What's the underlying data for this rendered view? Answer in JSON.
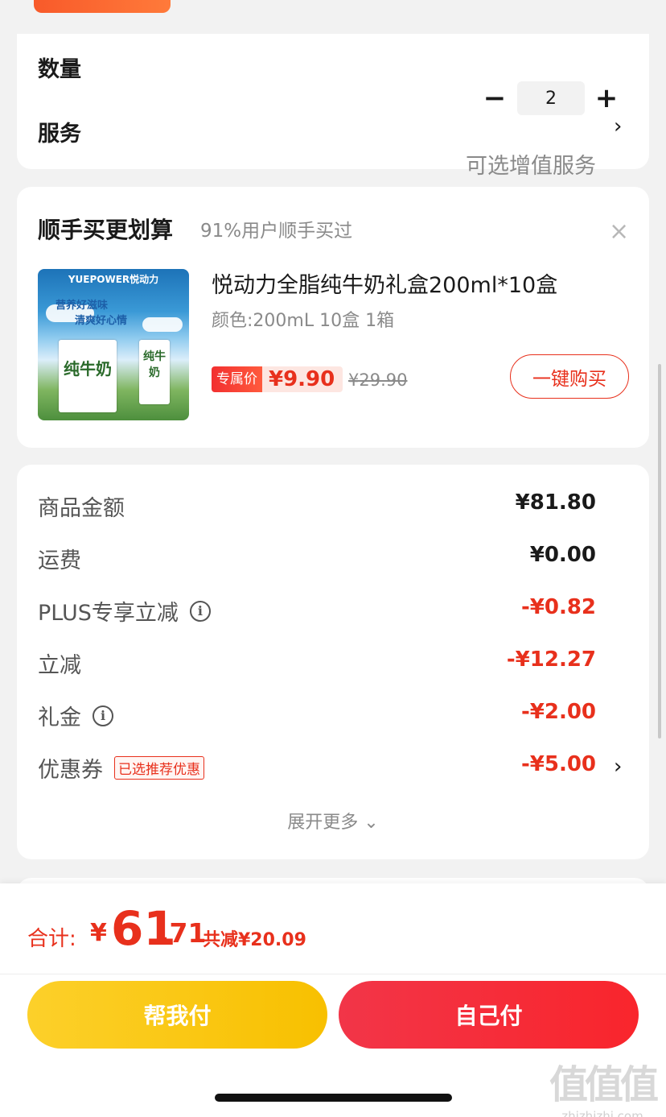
{
  "quantity": {
    "label": "数量",
    "minus": "−",
    "value": "2",
    "plus": "+"
  },
  "service": {
    "label": "服务",
    "value": "可选增值服务",
    "chevron": "›"
  },
  "upsell": {
    "title": "顺手买更划算",
    "subtitle": "91%用户顺手买过",
    "close": "×",
    "product": {
      "image_brand": "YUEPOWER悦动力",
      "image_slogan_1": "营养好滋味",
      "image_slogan_2": "清爽好心情",
      "image_box_text": "纯牛奶",
      "title": "悦动力全脂纯牛奶礼盒200ml*10盒",
      "spec": "颜色:200mL 10盒 1箱",
      "price_tag": "专属价",
      "price": "¥9.90",
      "original_price": "¥29.90",
      "buy_label": "一键购买"
    }
  },
  "amounts": {
    "rows": [
      {
        "label": "商品金额",
        "value": "¥81.80"
      },
      {
        "label": "运费",
        "value": "¥0.00"
      },
      {
        "label": "PLUS专享立减",
        "value": "-¥0.82"
      },
      {
        "label": "立减",
        "value": "-¥12.27"
      },
      {
        "label": "礼金",
        "value": "-¥2.00"
      },
      {
        "label": "优惠券",
        "tag": "已选推荐优惠",
        "value": "-¥5.00"
      }
    ],
    "expand_more": "展开更多 ⌄"
  },
  "footer": {
    "total_label": "合计:",
    "currency": "¥",
    "total_int": "61",
    "total_dec": ".71",
    "total_saved": "共减¥20.09",
    "help_pay_label": "帮我付",
    "self_pay_label": "自己付",
    "watermark_logo": "值值值",
    "watermark_text": "zhizhizhi.com"
  },
  "colors": {
    "accent_red": "#e8301c",
    "help_pay_yellow": "#f8c000",
    "self_pay_red": "#f9252c"
  }
}
